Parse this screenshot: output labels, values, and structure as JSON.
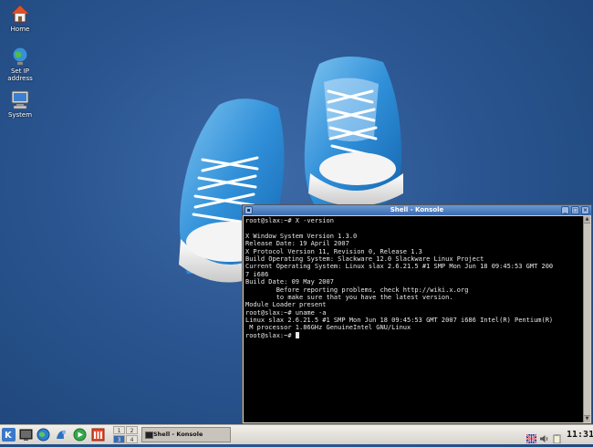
{
  "desktop": {
    "icons": [
      {
        "label": "Home"
      },
      {
        "label": "Set IP address"
      },
      {
        "label": "System"
      }
    ]
  },
  "konsole": {
    "title": "Shell - Konsole",
    "lines": [
      "root@slax:~# X -version",
      "",
      "X Window System Version 1.3.0",
      "Release Date: 19 April 2007",
      "X Protocol Version 11, Revision 0, Release 1.3",
      "Build Operating System: Slackware 12.0 Slackware Linux Project",
      "Current Operating System: Linux slax 2.6.21.5 #1 SMP Mon Jun 18 09:45:53 GMT 200",
      "7 i686",
      "Build Date: 09 May 2007",
      "        Before reporting problems, check http://wiki.x.org",
      "        to make sure that you have the latest version.",
      "Module Loader present",
      "root@slax:~# uname -a",
      "Linux slax 2.6.21.5 #1 SMP Mon Jun 18 09:45:53 GMT 2007 i686 Intel(R) Pentium(R)",
      " M processor 1.86GHz GenuineIntel GNU/Linux"
    ],
    "prompt": "root@slax:~# "
  },
  "taskbar": {
    "pager": [
      "1",
      "2",
      "3",
      "4"
    ],
    "task_label": "Shell - Konsole",
    "clock": "11:31"
  },
  "colors": {
    "desktop_bg": "#2a5590",
    "titlebar": "#3a6bb0",
    "terminal_bg": "#000000",
    "terminal_fg": "#e8e8e8"
  }
}
